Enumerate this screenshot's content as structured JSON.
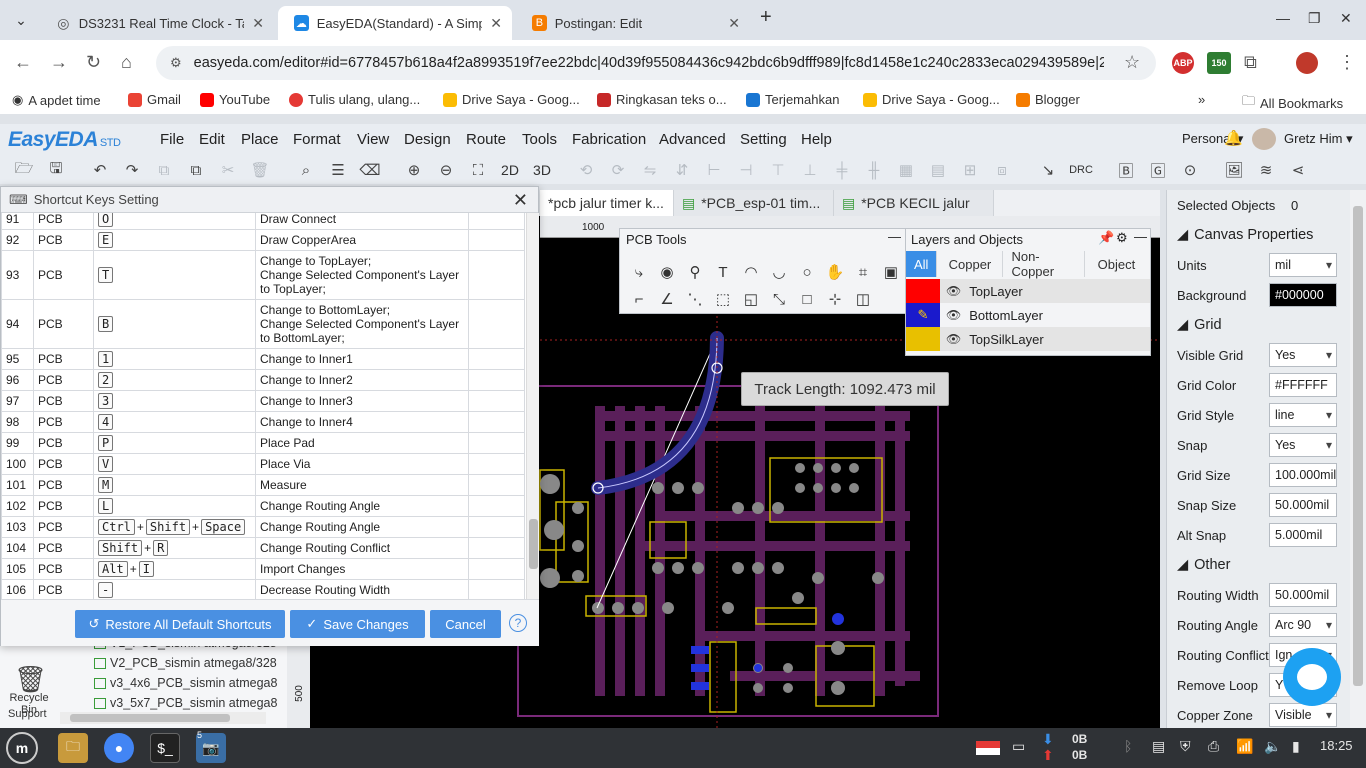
{
  "browser": {
    "tabs": [
      {
        "title": "DS3231 Real Time Clock - Ta",
        "icon": "globe-icon"
      },
      {
        "title": "EasyEDA(Standard) - A Simpl",
        "icon": "easyeda-icon"
      },
      {
        "title": "Postingan: Edit",
        "icon": "blogger-icon"
      }
    ],
    "url": "easyeda.com/editor#id=6778457b618a4f2a8993519f7ee22bdc|40d39f955084436c942bdc6b9dfff989|fc8d1458e1c240c2833eca029439589e|2...",
    "extension_badge": "150",
    "bookmarks": [
      "A apdet time",
      "Gmail",
      "YouTube",
      "Tulis ulang, ulang...",
      "Drive Saya - Goog...",
      "Ringkasan teks o...",
      "Terjemahkan",
      "Drive Saya - Goog...",
      "Blogger"
    ],
    "all_bookmarks": "All Bookmarks"
  },
  "app": {
    "logo": "EasyEDA",
    "logo_suffix": "STD",
    "menu": [
      "File",
      "Edit",
      "Place",
      "Format",
      "View",
      "Design",
      "Route",
      "Tools",
      "Fabrication",
      "Advanced",
      "Setting",
      "Help"
    ],
    "workspace_selector": "Personal ▾",
    "user": "Gretz Him ▾",
    "toolbar_text": {
      "view2d": "2D",
      "view3d": "3D",
      "drc": "DRC"
    }
  },
  "dialog": {
    "title": "Shortcut Keys Setting",
    "rows": [
      {
        "num": "91",
        "ctx": "PCB",
        "keys": [
          "O"
        ],
        "desc": [
          "Draw Connect"
        ]
      },
      {
        "num": "92",
        "ctx": "PCB",
        "keys": [
          "E"
        ],
        "desc": [
          "Draw CopperArea"
        ]
      },
      {
        "num": "93",
        "ctx": "PCB",
        "keys": [
          "T"
        ],
        "desc": [
          "Change to TopLayer;",
          "Change Selected Component's Layer",
          "to TopLayer;"
        ]
      },
      {
        "num": "94",
        "ctx": "PCB",
        "keys": [
          "B"
        ],
        "desc": [
          "Change to BottomLayer;",
          "Change Selected Component's Layer",
          "to BottomLayer;"
        ]
      },
      {
        "num": "95",
        "ctx": "PCB",
        "keys": [
          "1"
        ],
        "desc": [
          "Change to Inner1"
        ]
      },
      {
        "num": "96",
        "ctx": "PCB",
        "keys": [
          "2"
        ],
        "desc": [
          "Change to Inner2"
        ]
      },
      {
        "num": "97",
        "ctx": "PCB",
        "keys": [
          "3"
        ],
        "desc": [
          "Change to Inner3"
        ]
      },
      {
        "num": "98",
        "ctx": "PCB",
        "keys": [
          "4"
        ],
        "desc": [
          "Change to Inner4"
        ]
      },
      {
        "num": "99",
        "ctx": "PCB",
        "keys": [
          "P"
        ],
        "desc": [
          "Place Pad"
        ]
      },
      {
        "num": "100",
        "ctx": "PCB",
        "keys": [
          "V"
        ],
        "desc": [
          "Place Via"
        ]
      },
      {
        "num": "101",
        "ctx": "PCB",
        "keys": [
          "M"
        ],
        "desc": [
          "Measure"
        ]
      },
      {
        "num": "102",
        "ctx": "PCB",
        "keys": [
          "L"
        ],
        "desc": [
          "Change Routing Angle"
        ]
      },
      {
        "num": "103",
        "ctx": "PCB",
        "keys": [
          "Ctrl",
          "Shift",
          "Space"
        ],
        "desc": [
          "Change Routing Angle"
        ]
      },
      {
        "num": "104",
        "ctx": "PCB",
        "keys": [
          "Shift",
          "R"
        ],
        "desc": [
          "Change Routing Conflict"
        ]
      },
      {
        "num": "105",
        "ctx": "PCB",
        "keys": [
          "Alt",
          "I"
        ],
        "desc": [
          "Import Changes"
        ]
      },
      {
        "num": "106",
        "ctx": "PCB",
        "keys": [
          "-"
        ],
        "desc": [
          "Decrease Routing Width"
        ]
      }
    ],
    "buttons": {
      "restore": "Restore All Default Shortcuts",
      "save": "Save Changes",
      "cancel": "Cancel"
    }
  },
  "doc_tabs": [
    "*pcb jalur timer k...",
    "*PCB_esp-01 tim...",
    "*PCB KECIL jalur"
  ],
  "left_files": [
    "V1_PCB_sismin atmega8/328",
    "V2_PCB_sismin atmega8/328",
    "v3_4x6_PCB_sismin atmega8",
    "v3_5x7_PCB_sismin atmega8"
  ],
  "left_bottom": {
    "recycle": "Recycle Bin",
    "support": "Support"
  },
  "ruler": {
    "top_mark": "1000",
    "left_mark": "500"
  },
  "pcb_tools": {
    "title": "PCB Tools"
  },
  "layers": {
    "title": "Layers and Objects",
    "tabs": [
      "All",
      "Copper",
      "Non-Copper",
      "Object"
    ],
    "rows": [
      {
        "name": "TopLayer",
        "color": "#ff0000"
      },
      {
        "name": "BottomLayer",
        "color": "#0000ff"
      },
      {
        "name": "TopSilkLayer",
        "color": "#ffcc00"
      }
    ]
  },
  "track_tooltip": "Track Length: 1092.473 mil",
  "properties": {
    "selected_label": "Selected Objects",
    "selected_count": "0",
    "canvas_section": "Canvas Properties",
    "units_label": "Units",
    "units": "mil",
    "background_label": "Background",
    "background": "#000000",
    "grid_section": "Grid",
    "visible_grid_label": "Visible Grid",
    "visible_grid": "Yes",
    "grid_color_label": "Grid Color",
    "grid_color": "#FFFFFF",
    "grid_style_label": "Grid Style",
    "grid_style": "line",
    "snap_label": "Snap",
    "snap": "Yes",
    "grid_size_label": "Grid Size",
    "grid_size": "100.000mil",
    "snap_size_label": "Snap Size",
    "snap_size": "50.000mil",
    "alt_snap_label": "Alt Snap",
    "alt_snap": "5.000mil",
    "other_section": "Other",
    "routing_width_label": "Routing Width",
    "routing_width": "50.000mil",
    "routing_angle_label": "Routing Angle",
    "routing_angle": "Arc 90",
    "routing_conflict_label": "Routing Conflict",
    "routing_conflict": "Ign",
    "remove_loop_label": "Remove Loop",
    "remove_loop": "Y",
    "copper_zone_label": "Copper Zone",
    "copper_zone": "Visible"
  },
  "taskbar": {
    "badge": "5",
    "net_up": "0B",
    "net_down": "0B",
    "time": "18:25"
  }
}
